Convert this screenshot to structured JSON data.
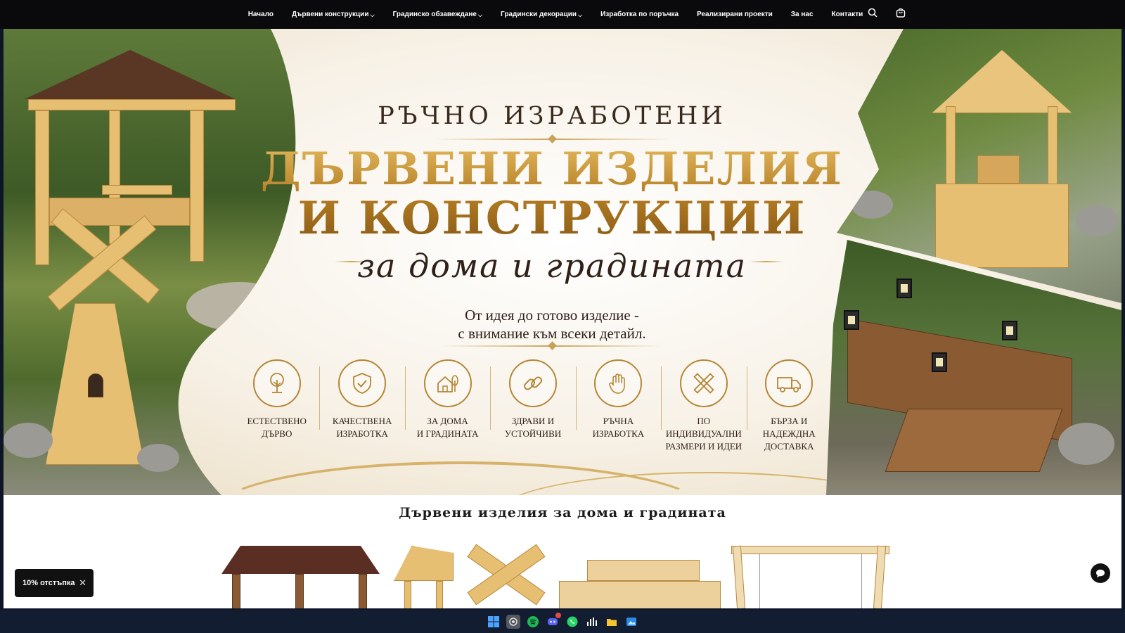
{
  "nav": {
    "items": [
      {
        "label": "Начало",
        "dropdown": false
      },
      {
        "label": "Дървени конструкции",
        "dropdown": true
      },
      {
        "label": "Градинско обзавеждане",
        "dropdown": true
      },
      {
        "label": "Градински декорации",
        "dropdown": true
      },
      {
        "label": "Изработка по поръчка",
        "dropdown": false
      },
      {
        "label": "Реализирани проекти",
        "dropdown": false
      },
      {
        "label": "За нас",
        "dropdown": false
      },
      {
        "label": "Контакти",
        "dropdown": false
      }
    ],
    "icons": [
      "search-icon",
      "cart-icon"
    ]
  },
  "hero": {
    "pre_title": "РЪЧНО ИЗРАБОТЕНИ",
    "title_line1": "ДЪРВЕНИ ИЗДЕЛИЯ",
    "title_line2": "И КОНСТРУКЦИИ",
    "script_line": "за дома и градината",
    "tagline_line1": "От идея до готово изделие -",
    "tagline_line2": "с внимание към всеки детайл.",
    "features": [
      {
        "icon": "tree-icon",
        "label": "ЕСТЕСТВЕНО\nДЪРВО"
      },
      {
        "icon": "shield-check-icon",
        "label": "КАЧЕСТВЕНА\nИЗРАБОТКА"
      },
      {
        "icon": "house-tree-icon",
        "label": "ЗА ДОМА\nИ ГРАДИНАТА"
      },
      {
        "icon": "link-icon",
        "label": "ЗДРАВИ И\nУСТОЙЧИВИ"
      },
      {
        "icon": "hand-icon",
        "label": "РЪЧНА\nИЗРАБОТКА"
      },
      {
        "icon": "ruler-pencil-icon",
        "label": "ПО ИНДИВИДУАЛНИ\nРАЗМЕРИ И ИДЕИ"
      },
      {
        "icon": "truck-icon",
        "label": "БЪРЗА И\nНАДЕЖДНА\nДОСТАВКА"
      }
    ]
  },
  "section": {
    "title": "Дървени изделия за дома и градината"
  },
  "discount": {
    "label": "10% отстъпка",
    "close": "✕"
  },
  "colors": {
    "gold": "#b8862c",
    "nav_bg": "#0a0a0c",
    "hero_cream": "#f7f1e6"
  },
  "taskbar": {
    "icons": [
      "windows-start-icon",
      "screen-record-icon",
      "spotify-icon",
      "discord-icon",
      "whatsapp-icon",
      "audio-icon",
      "file-explorer-icon",
      "photos-icon"
    ]
  }
}
